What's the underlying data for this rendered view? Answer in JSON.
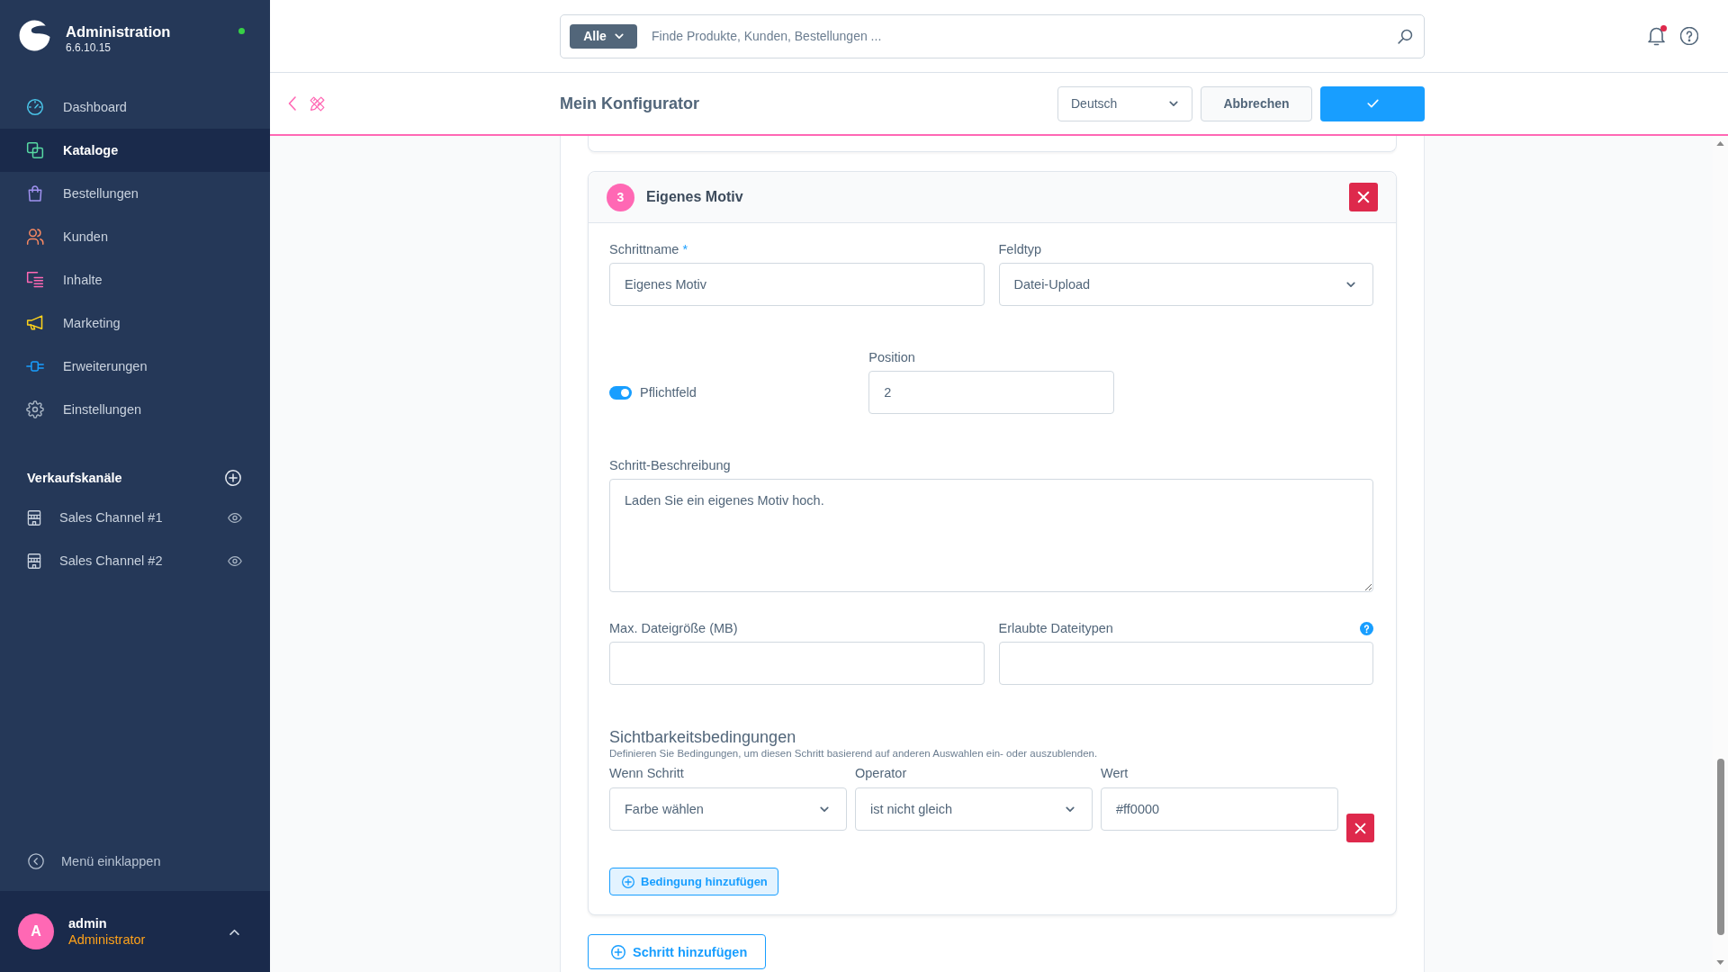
{
  "sidebar": {
    "brand": {
      "title": "Administration",
      "version": "6.6.10.15",
      "online": true
    },
    "nav": [
      {
        "label": "Dashboard",
        "selected": false
      },
      {
        "label": "Kataloge",
        "selected": true
      },
      {
        "label": "Bestellungen",
        "selected": false
      },
      {
        "label": "Kunden",
        "selected": false
      },
      {
        "label": "Inhalte",
        "selected": false
      },
      {
        "label": "Marketing",
        "selected": false
      },
      {
        "label": "Erweiterungen",
        "selected": false
      },
      {
        "label": "Einstellungen",
        "selected": false
      }
    ],
    "sales_channels": {
      "title": "Verkaufskanäle",
      "items": [
        {
          "label": "Sales Channel #1"
        },
        {
          "label": "Sales Channel #2"
        }
      ]
    },
    "collapse_label": "Menü einklappen",
    "user": {
      "initial": "A",
      "name": "admin",
      "role": "Administrator"
    }
  },
  "top_bar": {
    "search": {
      "scope": "Alle",
      "placeholder": "Finde Produkte, Kunden, Bestellungen ..."
    },
    "notifications": {
      "unread": true
    }
  },
  "page_header": {
    "title": "Mein Konfigurator",
    "language": "Deutsch",
    "cancel_label": "Abbrechen"
  },
  "step": {
    "number": "3",
    "title": "Eigenes Motiv",
    "rows": [
      [
        {
          "kind": "text",
          "label": "Schrittname",
          "required_mark": "*",
          "value": "Eigenes Motiv"
        },
        {
          "kind": "select",
          "label": "Feldtyp",
          "value": "Datei-Upload"
        }
      ],
      [
        {
          "kind": "toggle",
          "label": "Pflichtfeld",
          "on": true
        },
        {
          "kind": "text",
          "label": "Position",
          "value": "2"
        }
      ],
      [
        {
          "kind": "textarea",
          "label": "Schritt-Beschreibung",
          "value": "Laden Sie ein eigenes Motiv hoch."
        }
      ],
      [
        {
          "kind": "text",
          "label": "Max. Dateigröße (MB)"
        },
        {
          "kind": "text",
          "label": "Erlaubte Dateitypen",
          "help": true
        }
      ]
    ],
    "conditions": {
      "title": "Sichtbarkeitsbedingungen",
      "description": "Definieren Sie Bedingungen, um diesen Schritt basierend auf anderen Auswahlen ein- oder auszublenden.",
      "items": [
        {
          "fields": [
            {
              "kind": "select",
              "label": "Wenn Schritt",
              "value": "Farbe wählen"
            },
            {
              "kind": "select",
              "label": "Operator",
              "value": "ist nicht gleich"
            },
            {
              "kind": "text",
              "label": "Wert",
              "value": "#ff0000"
            }
          ]
        }
      ],
      "add_label": "Bedingung hinzufügen"
    }
  },
  "add_step_label": "Schritt hinzufügen"
}
